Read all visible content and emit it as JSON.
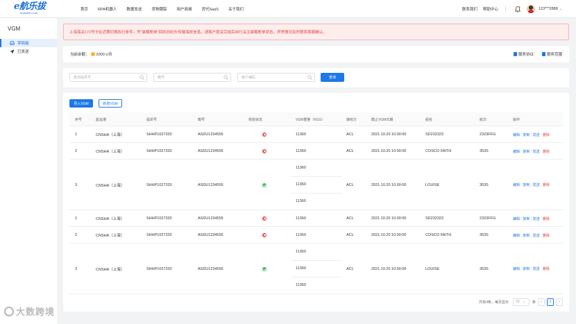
{
  "logo": {
    "main": "e航乐拔",
    "sub": "ehanlebo.com"
  },
  "nav": [
    "首页",
    "RPA机器人",
    "数据发送",
    "货物跟踪",
    "用户商城",
    "货代SaaS",
    "关于我们"
  ],
  "header_right": {
    "contact": "联系我们",
    "help": "帮助中心",
    "user": "123***2888"
  },
  "sidebar": {
    "title": "VGM",
    "items": [
      {
        "label": "草稿箱"
      },
      {
        "label": "已发送"
      }
    ]
  },
  "notice": "上海海关172号令在近期切换执行条件，凭\"装载舱单\"回执向码头传输海放信息。请客户提关完成后自行关注装载舱单状态，异常情况及时联系客服确认。",
  "balance": {
    "label": "当前余额：",
    "value": "2000 U币",
    "links": [
      "服务协议",
      "服务范围"
    ]
  },
  "search": {
    "placeholders": [
      "查询提单号",
      "箱号",
      "客户编码"
    ],
    "button": "查询"
  },
  "actions": {
    "import": "导入VGM",
    "add": "新增VGM"
  },
  "table": {
    "headers": [
      "序号",
      "起运港",
      "提单号",
      "箱号",
      "校验状态",
      "VGM重量（KGS）",
      "接收方",
      "截止VGM日期",
      "船名",
      "航次",
      "操作"
    ],
    "ops": [
      "编辑",
      "复制",
      "发送",
      "删除"
    ],
    "rows": [
      {
        "no": "1",
        "pol": "CNSHA（上海）",
        "bl": "SHHP1027320",
        "ctn": "ASDU1234555",
        "status": "error",
        "weights": [
          "11360"
        ],
        "receiver": "ACL",
        "date": "2021.10.20 10:00:00",
        "vessel": "SD232323",
        "voyage": "2323FFG"
      },
      {
        "no": "2",
        "pol": "CNSHA（上海）",
        "bl": "SHHP1027320",
        "ctn": "ASDU1234555",
        "status": "error",
        "weights": [
          "11360"
        ],
        "receiver": "ACL",
        "date": "2021.10.20 10:00:00",
        "vessel": "COSCO FAITH",
        "voyage": "353S"
      },
      {
        "no": "3",
        "pol": "CNSHA（上海）",
        "bl": "SHHP1027320",
        "ctn": "ASDU1234555",
        "status": "ok",
        "weights": [
          "11360",
          "11360",
          "11360"
        ],
        "receiver": "ACL",
        "date": "2021.10.20 10:00:00",
        "vessel": "LOUISE",
        "voyage": "353S"
      },
      {
        "no": "1",
        "pol": "CNSHA（上海）",
        "bl": "SHHP1027320",
        "ctn": "ASDU1234555",
        "status": "error",
        "weights": [
          "11360"
        ],
        "receiver": "ACL",
        "date": "2021.10.20 10:00:00",
        "vessel": "SD232323",
        "voyage": "2323FFG"
      },
      {
        "no": "2",
        "pol": "CNSHA（上海）",
        "bl": "SHHP1027320",
        "ctn": "ASDU1234555",
        "status": "error",
        "weights": [
          "11360"
        ],
        "receiver": "ACL",
        "date": "2021.10.20 10:00:00",
        "vessel": "COSCO FAITH",
        "voyage": "353S"
      },
      {
        "no": "3",
        "pol": "CNSHA（上海）",
        "bl": "SHHP1027320",
        "ctn": "ASDU1234555",
        "status": "ok",
        "weights": [
          "11360",
          "11360",
          "11360"
        ],
        "receiver": "ACL",
        "date": "2021.10.20 10:00:00",
        "vessel": "LOUISE",
        "voyage": "353S"
      }
    ]
  },
  "pagination": {
    "total": "共有4条，每页显示",
    "page_size": "10",
    "unit": "条",
    "current": "1"
  },
  "watermark": "大数跨境",
  "colors": {
    "primary": "#1e78e6",
    "danger": "#e0453b",
    "success": "#3dbd5c",
    "notice_bg": "#fdeded"
  }
}
